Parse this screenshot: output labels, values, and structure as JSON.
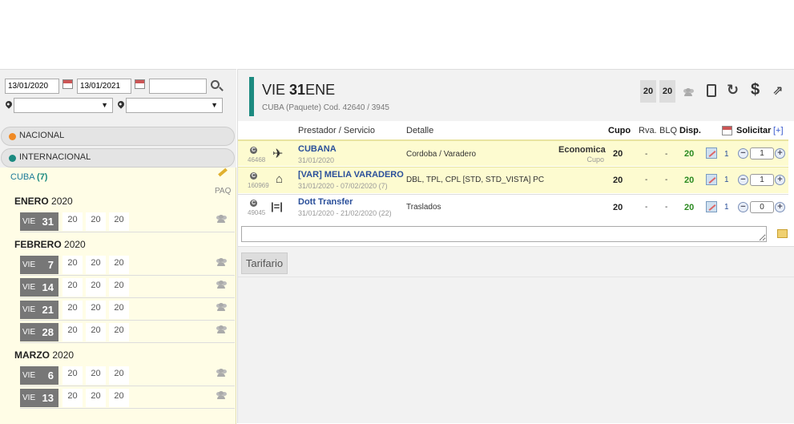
{
  "search": {
    "date_from": "13/01/2020",
    "date_to": "13/01/2021",
    "text": "",
    "origin": "",
    "destination": ""
  },
  "categories": [
    {
      "label": "NACIONAL",
      "color": "#f08a24"
    },
    {
      "label": "INTERNACIONAL",
      "color": "#1c8a80"
    }
  ],
  "destination_panel": {
    "name": "CUBA",
    "count": "(7)",
    "paq_label": "PAQ"
  },
  "months": [
    {
      "name": "ENERO",
      "year": "2020",
      "days": [
        {
          "dn": "VIE",
          "dd": "31",
          "v": [
            "20",
            "20",
            "20"
          ]
        }
      ]
    },
    {
      "name": "FEBRERO",
      "year": "2020",
      "days": [
        {
          "dn": "VIE",
          "dd": "7",
          "v": [
            "20",
            "20",
            "20"
          ]
        },
        {
          "dn": "VIE",
          "dd": "14",
          "v": [
            "20",
            "20",
            "20"
          ]
        },
        {
          "dn": "VIE",
          "dd": "21",
          "v": [
            "20",
            "20",
            "20"
          ]
        },
        {
          "dn": "VIE",
          "dd": "28",
          "v": [
            "20",
            "20",
            "20"
          ]
        }
      ]
    },
    {
      "name": "MARZO",
      "year": "2020",
      "days": [
        {
          "dn": "VIE",
          "dd": "6",
          "v": [
            "20",
            "20",
            "20"
          ]
        },
        {
          "dn": "VIE",
          "dd": "13",
          "v": [
            "20",
            "20",
            "20"
          ]
        }
      ]
    }
  ],
  "header": {
    "weekday": "VIE",
    "day": "31",
    "month": "ENE",
    "subtitle": "CUBA (Paquete) Cod. 42640 / 3945",
    "counts": [
      "20",
      "20"
    ]
  },
  "table": {
    "columns": {
      "prestador": "Prestador / Servicio",
      "detalle": "Detalle",
      "cupo": "Cupo",
      "rva": "Rva.",
      "blq": "BLQ",
      "disp": "Disp.",
      "solicitar": "Solicitar",
      "add": "[+]"
    },
    "rows": [
      {
        "badge": "C",
        "code": "46468",
        "icon": "plane-icon",
        "name": "CUBANA",
        "dates": "31/01/2020",
        "detalle": "Cordoba / Varadero",
        "cls": "Economica",
        "cls_sub": "Cupo",
        "cupo": "20",
        "rva": "-",
        "blq": "-",
        "disp": "20",
        "n": "1",
        "qty": "1",
        "bg": "#fdfbd0"
      },
      {
        "badge": "C",
        "code": "160969",
        "icon": "hotel-icon",
        "name": "[VAR] MELIA VARADERO",
        "dates": "31/01/2020 - 07/02/2020 (7)",
        "detalle": "DBL, TPL, CPL [STD, STD_VISTA] PC",
        "cls": "",
        "cls_sub": "",
        "cupo": "20",
        "rva": "-",
        "blq": "-",
        "disp": "20",
        "n": "1",
        "qty": "1",
        "bg": "#fdfbd0"
      },
      {
        "badge": "C",
        "code": "49045",
        "icon": "transfer-icon",
        "name": "Dott Transfer",
        "dates": "31/01/2020 - 21/02/2020 (22)",
        "detalle": "Traslados",
        "cls": "",
        "cls_sub": "",
        "cupo": "20",
        "rva": "-",
        "blq": "-",
        "disp": "20",
        "n": "1",
        "qty": "0",
        "bg": "#ffffff"
      }
    ]
  },
  "tabs": {
    "tarifario": "Tarifario"
  }
}
